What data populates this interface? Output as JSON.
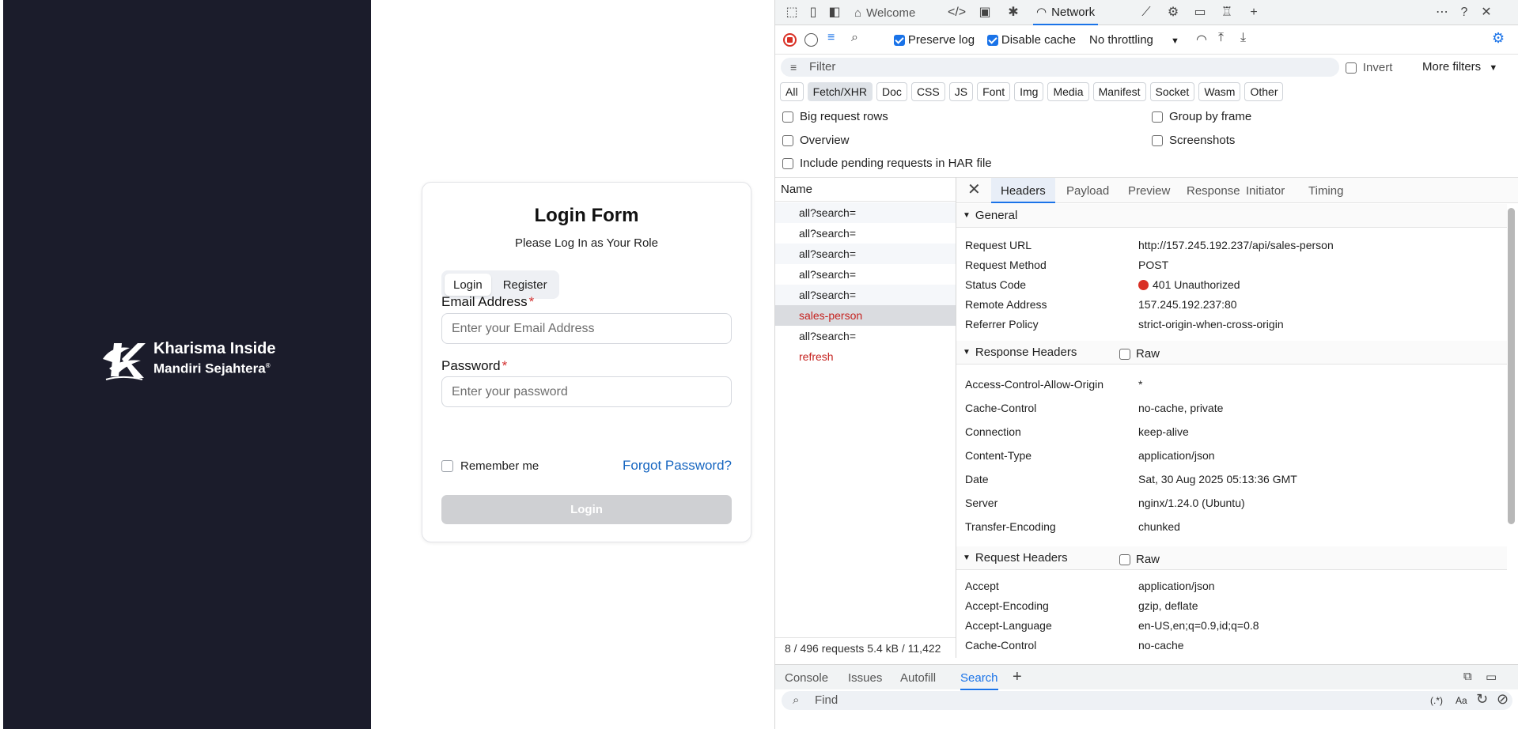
{
  "brand": {
    "name_line1": "Kharisma Inside",
    "name_line2": "Mandiri Sejahtera",
    "registered": "®"
  },
  "login": {
    "title": "Login Form",
    "subtitle": "Please Log In as Your Role",
    "tabs": [
      "Login",
      "Register"
    ],
    "email_label": "Email Address",
    "email_placeholder": "Enter your Email Address",
    "password_label": "Password",
    "password_placeholder": "Enter your password",
    "required_mark": "*",
    "remember": "Remember me",
    "forgot": "Forgot Password?",
    "submit": "Login"
  },
  "devtools": {
    "tabs": {
      "welcome": "Welcome",
      "network": "Network"
    },
    "toolbar": {
      "preserve_log": "Preserve log",
      "disable_cache": "Disable cache",
      "throttling": "No throttling"
    },
    "filter": {
      "placeholder": "Filter",
      "invert": "Invert",
      "more_filters": "More filters"
    },
    "type_chips": [
      "All",
      "Fetch/XHR",
      "Doc",
      "CSS",
      "JS",
      "Font",
      "Img",
      "Media",
      "Manifest",
      "Socket",
      "Wasm",
      "Other"
    ],
    "options": {
      "big_rows": "Big request rows",
      "group_by_frame": "Group by frame",
      "overview": "Overview",
      "screenshots": "Screenshots",
      "har": "Include pending requests in HAR file"
    },
    "name_header": "Name",
    "requests": [
      "all?search=",
      "all?search=",
      "all?search=",
      "all?search=",
      "all?search=",
      "sales-person",
      "all?search=",
      "refresh"
    ],
    "status_summary": "8 / 496 requests   5.4 kB / 11,422",
    "detail_tabs": [
      "Headers",
      "Payload",
      "Preview",
      "Response",
      "Initiator",
      "Timing"
    ],
    "general": {
      "title": "General",
      "rows": [
        {
          "k": "Request URL",
          "v": "http://157.245.192.237/api/sales-person"
        },
        {
          "k": "Request Method",
          "v": "POST"
        },
        {
          "k": "Status Code",
          "v": "401 Unauthorized"
        },
        {
          "k": "Remote Address",
          "v": "157.245.192.237:80"
        },
        {
          "k": "Referrer Policy",
          "v": "strict-origin-when-cross-origin"
        }
      ]
    },
    "response_headers": {
      "title": "Response Headers",
      "raw": "Raw",
      "rows": [
        {
          "k": "Access-Control-Allow-Origin",
          "v": "*"
        },
        {
          "k": "Cache-Control",
          "v": "no-cache, private"
        },
        {
          "k": "Connection",
          "v": "keep-alive"
        },
        {
          "k": "Content-Type",
          "v": "application/json"
        },
        {
          "k": "Date",
          "v": "Sat, 30 Aug 2025 05:13:36 GMT"
        },
        {
          "k": "Server",
          "v": "nginx/1.24.0 (Ubuntu)"
        },
        {
          "k": "Transfer-Encoding",
          "v": "chunked"
        }
      ]
    },
    "request_headers": {
      "title": "Request Headers",
      "raw": "Raw",
      "rows": [
        {
          "k": "Accept",
          "v": "application/json"
        },
        {
          "k": "Accept-Encoding",
          "v": "gzip, deflate"
        },
        {
          "k": "Accept-Language",
          "v": "en-US,en;q=0.9,id;q=0.8"
        },
        {
          "k": "Cache-Control",
          "v": "no-cache"
        }
      ]
    },
    "drawer_tabs": [
      "Console",
      "Issues",
      "Autofill",
      "Search"
    ],
    "find_placeholder": "Find",
    "find_regex": "(.*)",
    "find_case": "Aa",
    "colors": {
      "accent": "#1a73e8",
      "error": "#c5221f",
      "status_dot": "#d93025",
      "brand_bg": "#1b1c2b"
    }
  }
}
